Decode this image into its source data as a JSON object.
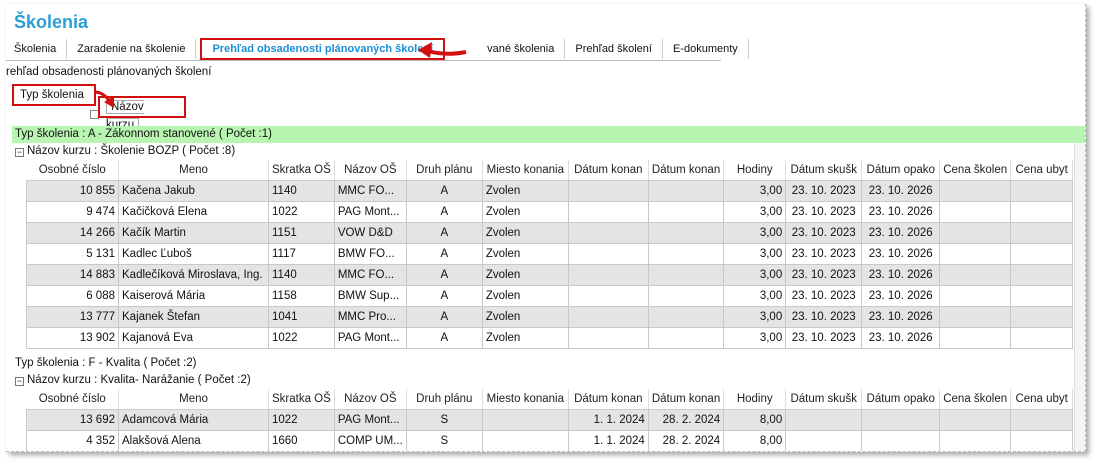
{
  "app": {
    "title": "Školenia"
  },
  "tabs": [
    {
      "label": "Školenia"
    },
    {
      "label": "Zaradenie na školenie"
    },
    {
      "label": "Prehľad obsadenosti plánovaných školení"
    },
    {
      "label": "vané školenia"
    },
    {
      "label": "Prehľad školení"
    },
    {
      "label": "E-dokumenty"
    }
  ],
  "page_heading": "rehľad obsadenosti plánovaných školení",
  "grouping": {
    "group1": "Typ školenia",
    "group2": "Názov kurzu"
  },
  "columns": [
    "Osobné číslo",
    "Meno",
    "Skratka OŠ",
    "Názov OŠ",
    "Druh plánu",
    "Miesto konania",
    "Dátum konan",
    "Dátum konan",
    "Hodiny",
    "Dátum skušk",
    "Dátum opako",
    "Cena školen",
    "Cena ubyt"
  ],
  "groups": [
    {
      "type_header": "Typ školenia : A - Zákonnom stanovené ( Počet :1)",
      "course_header": "Názov kurzu : Školenie BOZP ( Počet :8)",
      "rows": [
        [
          "10 855",
          "Kačena Jakub",
          "1140",
          "MMC FO...",
          "A",
          "Zvolen",
          "",
          "",
          "3,00",
          "23. 10. 2023",
          "23. 10. 2026",
          "",
          ""
        ],
        [
          "9 474",
          "Kačičková Elena",
          "1022",
          "PAG Mont...",
          "A",
          "Zvolen",
          "",
          "",
          "3,00",
          "23. 10. 2023",
          "23. 10. 2026",
          "",
          ""
        ],
        [
          "14 266",
          "Kačík Martin",
          "1151",
          "VOW D&D",
          "A",
          "Zvolen",
          "",
          "",
          "3,00",
          "23. 10. 2023",
          "23. 10. 2026",
          "",
          ""
        ],
        [
          "5 131",
          "Kadlec Ľuboš",
          "1117",
          "BMW FO...",
          "A",
          "Zvolen",
          "",
          "",
          "3,00",
          "23. 10. 2023",
          "23. 10. 2026",
          "",
          ""
        ],
        [
          "14 883",
          "Kadlečíková Miroslava, Ing.",
          "1140",
          "MMC FO...",
          "A",
          "Zvolen",
          "",
          "",
          "3,00",
          "23. 10. 2023",
          "23. 10. 2026",
          "",
          ""
        ],
        [
          "6 088",
          "Kaiserová Mária",
          "1158",
          "BMW Sup...",
          "A",
          "Zvolen",
          "",
          "",
          "3,00",
          "23. 10. 2023",
          "23. 10. 2026",
          "",
          ""
        ],
        [
          "13 777",
          "Kajanek Štefan",
          "1041",
          "MMC Pro...",
          "A",
          "Zvolen",
          "",
          "",
          "3,00",
          "23. 10. 2023",
          "23. 10. 2026",
          "",
          ""
        ],
        [
          "13 902",
          "Kajanová Eva",
          "1022",
          "PAG Mont...",
          "A",
          "Zvolen",
          "",
          "",
          "3,00",
          "23. 10. 2023",
          "23. 10. 2026",
          "",
          ""
        ]
      ]
    },
    {
      "type_header": "Typ školenia : F - Kvalita ( Počet :2)",
      "course_header": "Názov kurzu : Kvalita- Narážanie ( Počet :2)",
      "rows": [
        [
          "13 692",
          "Adamcová Mária",
          "1022",
          "PAG Mont...",
          "S",
          "",
          "1. 1. 2024",
          "28. 2. 2024",
          "8,00",
          "",
          "",
          "",
          ""
        ],
        [
          "4 352",
          "Alakšová Alena",
          "1660",
          "COMP UM...",
          "S",
          "",
          "1. 1. 2024",
          "28. 2. 2024",
          "8,00",
          "",
          "",
          "",
          ""
        ]
      ]
    }
  ],
  "colors": {
    "accent": "#2a9fd6",
    "annotation": "#d21010",
    "group_band": "#b7f5b0"
  }
}
